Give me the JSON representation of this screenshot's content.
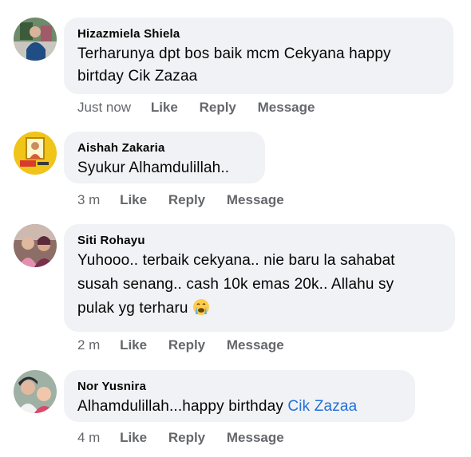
{
  "comments": [
    {
      "author": "Hizazmiela Shiela",
      "lines": [
        "Terharunya dpt bos baik mcm Cekyana happy",
        "birtday Cik Zazaa"
      ],
      "time": "Just now",
      "actions": {
        "like": "Like",
        "reply": "Reply",
        "message": "Message"
      }
    },
    {
      "author": "Aishah Zakaria",
      "lines": [
        "Syukur Alhamdulillah.."
      ],
      "time": "3 m",
      "actions": {
        "like": "Like",
        "reply": "Reply",
        "message": "Message"
      }
    },
    {
      "author": "Siti Rohayu",
      "lines": [
        "Yuhooo.. terbaik cekyana.. nie baru la sahabat",
        "susah senang.. cash 10k emas 20k.. Allahu sy",
        "pulak yg terharu"
      ],
      "emoji": "crying-face-emoji",
      "time": "2 m",
      "actions": {
        "like": "Like",
        "reply": "Reply",
        "message": "Message"
      }
    },
    {
      "author": "Nor Yusnira",
      "text_prefix": "Alhamdulillah...happy birthday ",
      "mention": "Cik Zazaa",
      "time": "4 m",
      "actions": {
        "like": "Like",
        "reply": "Reply",
        "message": "Message"
      }
    }
  ],
  "colors": {
    "bubble": "#f0f2f5",
    "meta": "#65676b",
    "mention": "#216fdb"
  }
}
